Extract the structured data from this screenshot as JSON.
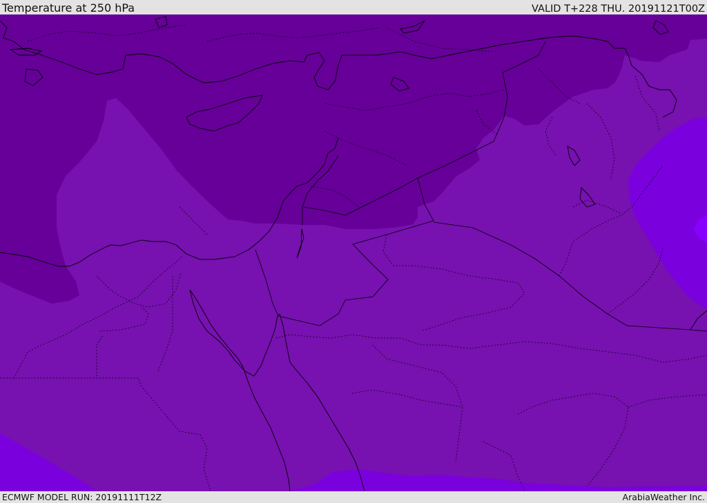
{
  "header": {
    "title": "Temperature at 250 hPa",
    "valid": "VALID T+228 THU. 20191121T00Z"
  },
  "footer": {
    "model_run": "ECMWF MODEL RUN: 20191111T12Z",
    "credit": "ArabiaWeather Inc."
  },
  "map": {
    "colors": {
      "coldest": "#660099",
      "mid": "#7711b0",
      "warm": "#7a00dd",
      "warmest": "#8800ff",
      "coastline": "#000000",
      "border": "#000000"
    }
  }
}
